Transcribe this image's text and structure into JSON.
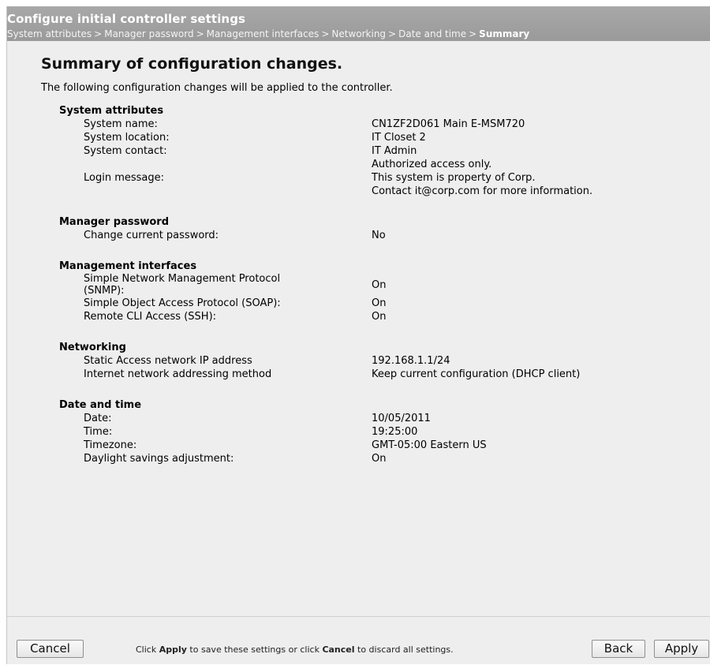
{
  "header": {
    "title": "Configure initial controller settings",
    "breadcrumb": [
      "System attributes",
      "Manager password",
      "Management interfaces",
      "Networking",
      "Date and time"
    ],
    "breadcrumb_current": "Summary",
    "separator": ">"
  },
  "main": {
    "heading": "Summary of configuration changes.",
    "intro": "The following configuration changes will be applied to the controller.",
    "sections": {
      "system": {
        "title": "System attributes",
        "name_label": "System name:",
        "name_value": "CN1ZF2D061 Main E-MSM720",
        "location_label": "System location:",
        "location_value": "IT Closet 2",
        "contact_label": "System contact:",
        "contact_value": "IT Admin",
        "login_label": "Login message:",
        "login_lines": [
          "Authorized access only.",
          "This system is property of Corp.",
          "Contact it@corp.com for more information."
        ]
      },
      "password": {
        "title": "Manager password",
        "change_label": "Change current password:",
        "change_value": "No"
      },
      "mgmt": {
        "title": "Management interfaces",
        "snmp_label_1": "Simple Network Management Protocol",
        "snmp_label_2": "(SNMP):",
        "snmp_value": "On",
        "soap_label": "Simple Object Access Protocol (SOAP):",
        "soap_value": "On",
        "ssh_label": "Remote CLI Access (SSH):",
        "ssh_value": "On"
      },
      "networking": {
        "title": "Networking",
        "ip_label": "Static Access network IP address",
        "ip_value": "192.168.1.1/24",
        "method_label": "Internet network addressing method",
        "method_value": "Keep current configuration (DHCP client)"
      },
      "datetime": {
        "title": "Date and time",
        "date_label": "Date:",
        "date_value": "10/05/2011",
        "time_label": "Time:",
        "time_value": "19:25:00",
        "tz_label": "Timezone:",
        "tz_value": "GMT-05:00 Eastern US",
        "dst_label": "Daylight savings adjustment:",
        "dst_value": "On"
      }
    }
  },
  "footer": {
    "cancel_label": "Cancel",
    "back_label": "Back",
    "apply_label": "Apply",
    "hint_1": "Click ",
    "hint_apply": "Apply",
    "hint_2": " to save these settings or click ",
    "hint_cancel": "Cancel",
    "hint_3": " to discard all settings."
  },
  "colors": {
    "header_bg": "#a3a3a3",
    "panel_bg": "#eeeeee"
  }
}
